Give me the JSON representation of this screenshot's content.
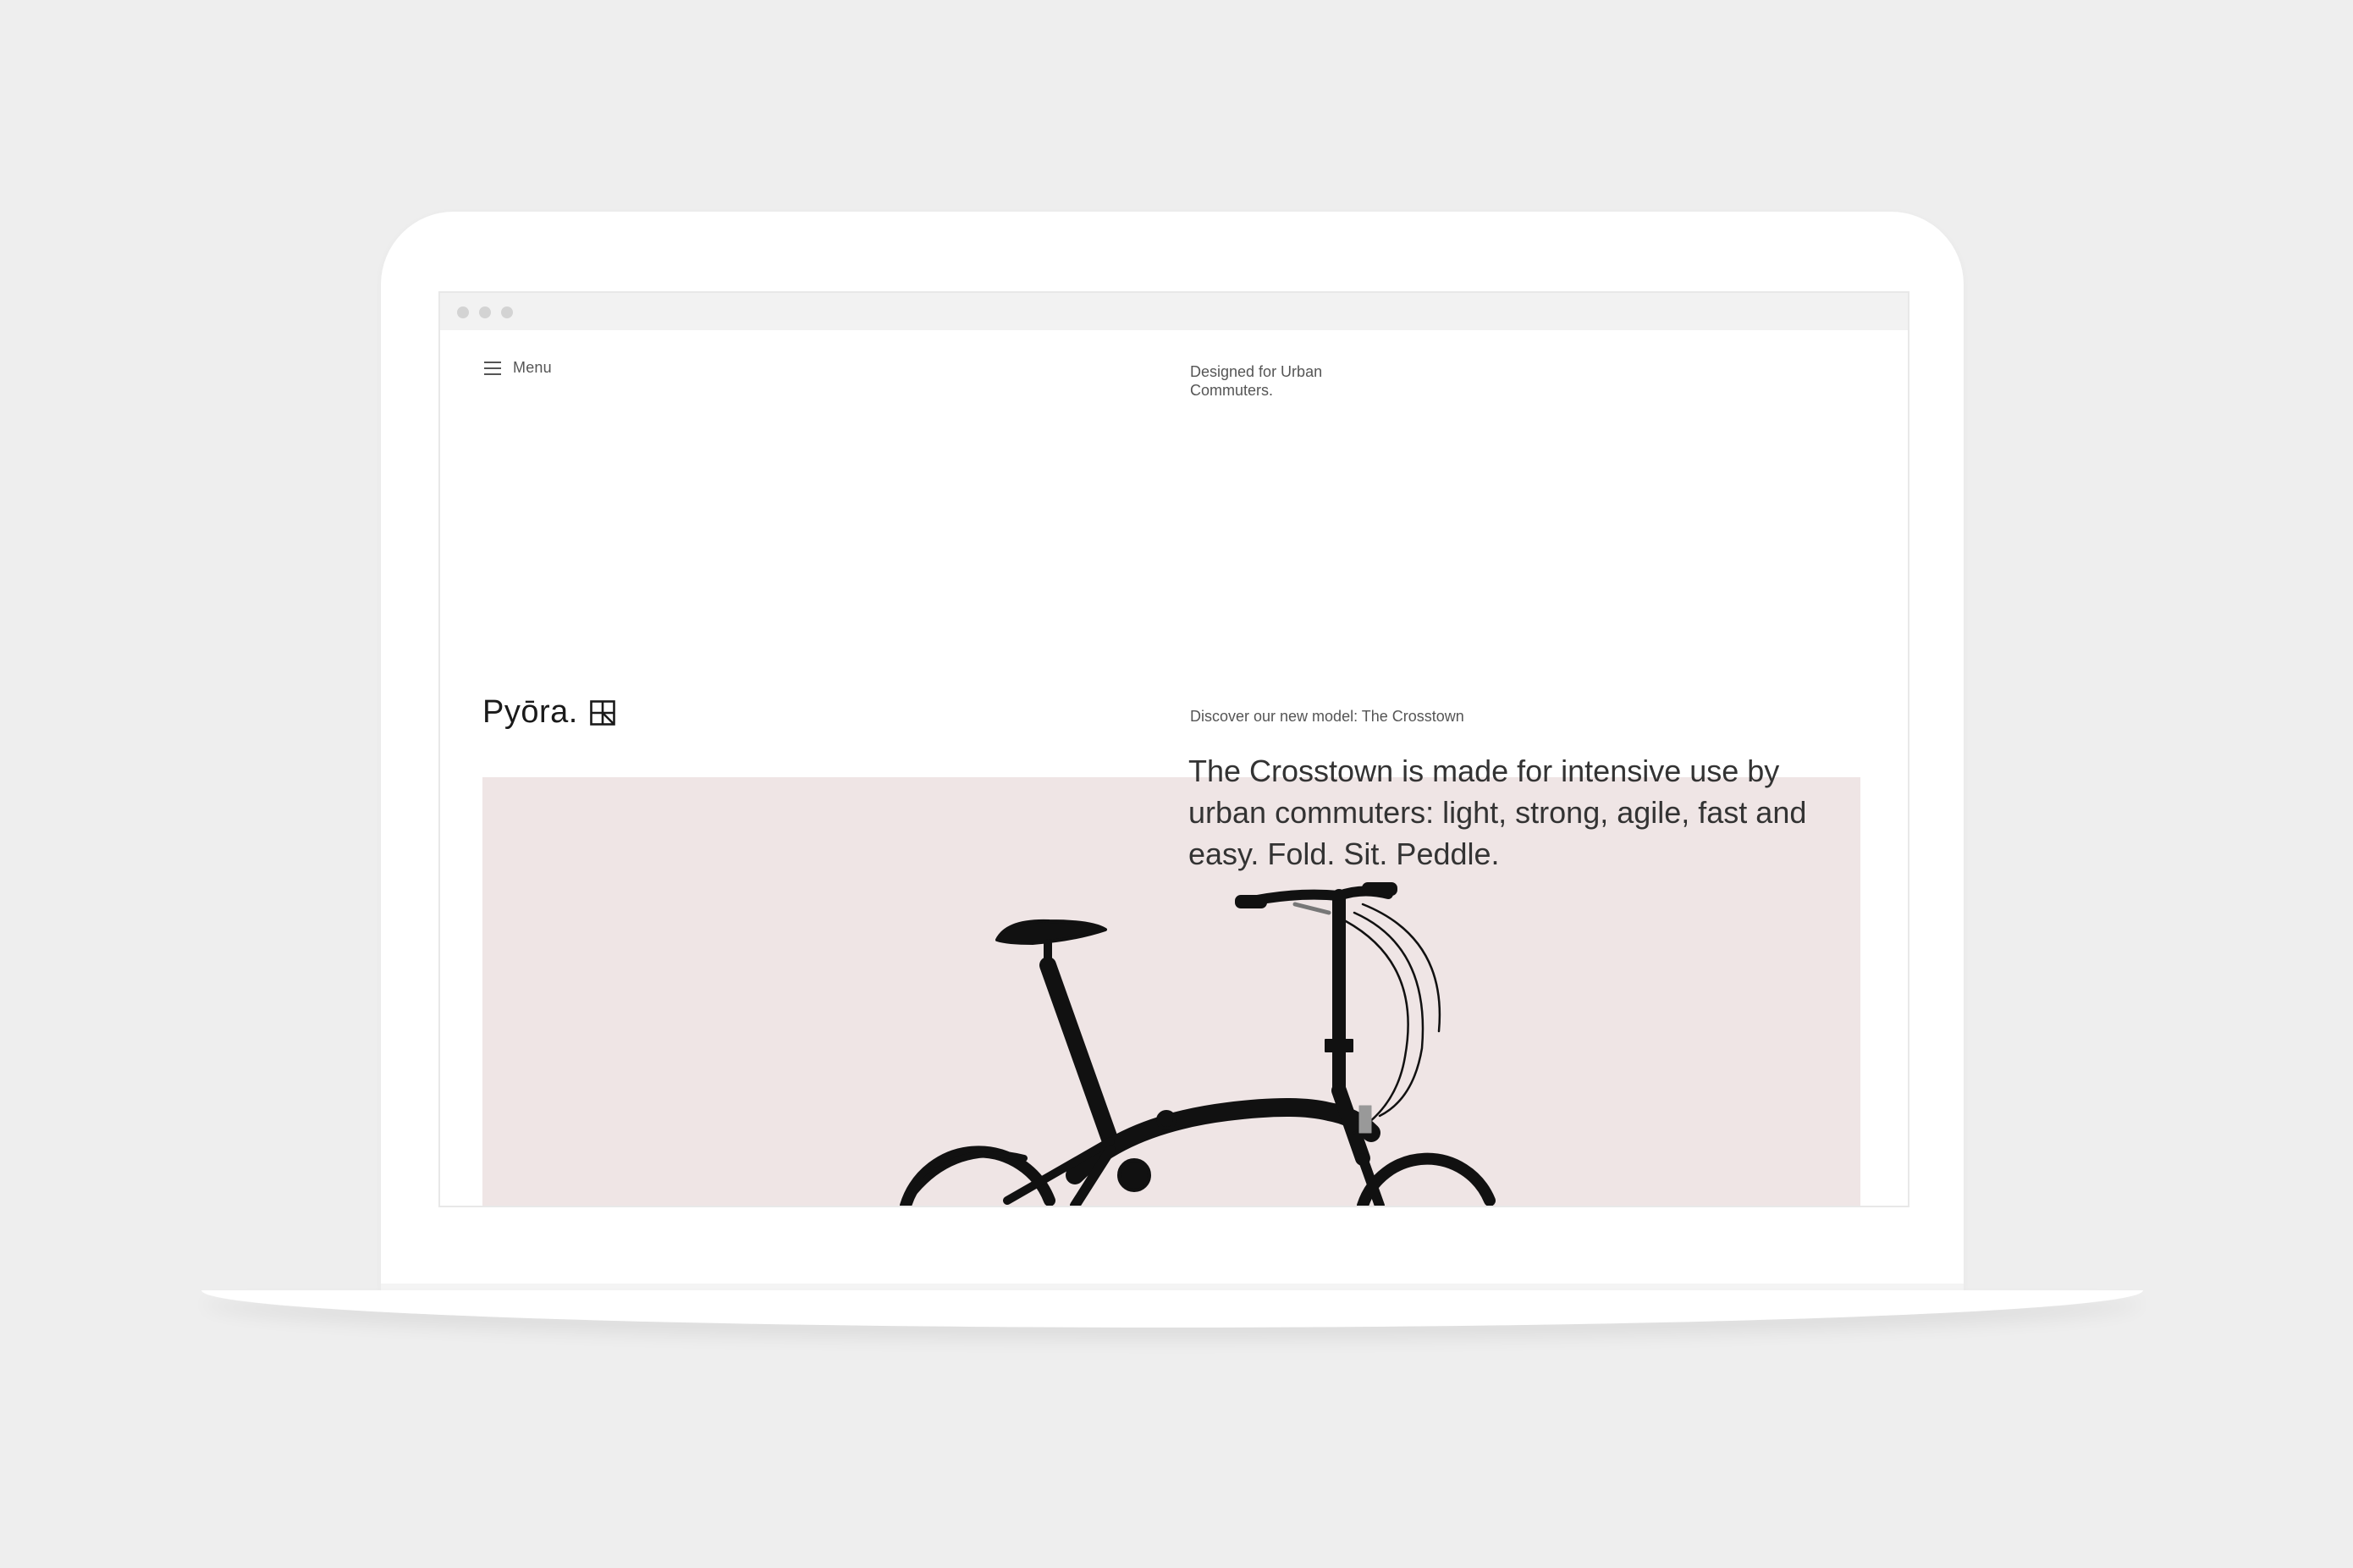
{
  "nav": {
    "menu_label": "Menu"
  },
  "header": {
    "tagline": "Designed for Urban Commuters."
  },
  "brand": {
    "logo_text": "Pyōra."
  },
  "hero": {
    "eyebrow": "Discover our new model: The Crosstown",
    "headline": "The Crosstown is made for intensive use by urban commuters: light, strong, agile, fast and easy. Fold. Sit. Peddle.",
    "image_subject": "folding-bicycle"
  },
  "colors": {
    "background": "#eeeeee",
    "hero_bg": "#efe5e5",
    "text": "#333333"
  }
}
